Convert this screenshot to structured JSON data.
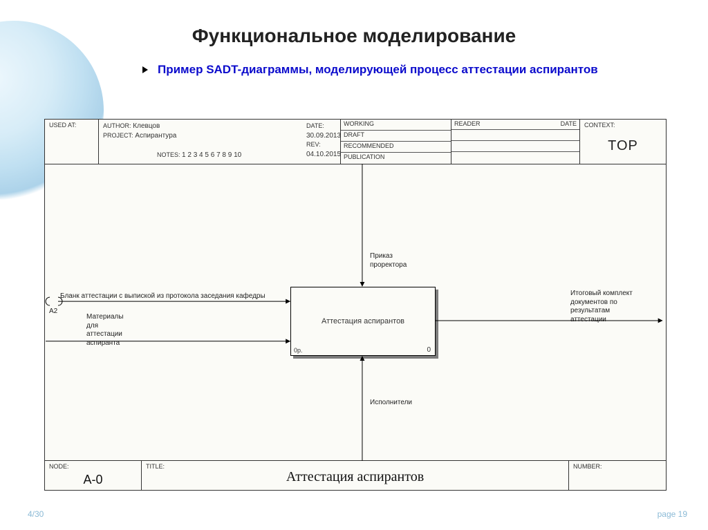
{
  "page": {
    "title": "Функциональное моделирование",
    "subtitle": "Пример SADT-диаграммы, моделирующей процесс аттестации аспирантов",
    "counter": "4/30",
    "page_number": "page 19"
  },
  "header": {
    "used_at_label": "USED AT:",
    "author_label": "AUTHOR:",
    "author_value": "Клевцов",
    "project_label": "PROJECT:",
    "project_value": "Аспирантура",
    "date_label": "DATE:",
    "date_value": "30.09.2013",
    "rev_label": "REV:",
    "rev_value": "04.10.2015",
    "notes_label": "NOTES:",
    "notes_value": "1 2 3 4 5 6 7 8 9 10",
    "status": {
      "working": "WORKING",
      "draft": "DRAFT",
      "recommended": "RECOMMENDED",
      "publication": "PUBLICATION"
    },
    "reader_label": "READER",
    "reader_date_label": "DATE",
    "context_label": "CONTEXT:",
    "context_value": "TOP"
  },
  "process": {
    "name": "Аттестация аспирантов",
    "id_left": "0р.",
    "id_right": "0"
  },
  "arrows": {
    "control": "Приказ проректора",
    "input1": "Бланк аттестации с выпиской из протокола заседания кафедры",
    "input1_call": "A2",
    "input2_l1": "Материалы",
    "input2_l2": "для",
    "input2_l3": "аттестации",
    "input2_l4": "аспиранта",
    "output_l1": "Итоговый комплект",
    "output_l2": "документов по",
    "output_l3": "результатам",
    "output_l4": "аттестации",
    "mechanism": "Исполнители"
  },
  "footer": {
    "node_label": "NODE:",
    "node_value": "A-0",
    "title_label": "TITLE:",
    "title_value": "Аттестация аспирантов",
    "number_label": "NUMBER:"
  }
}
